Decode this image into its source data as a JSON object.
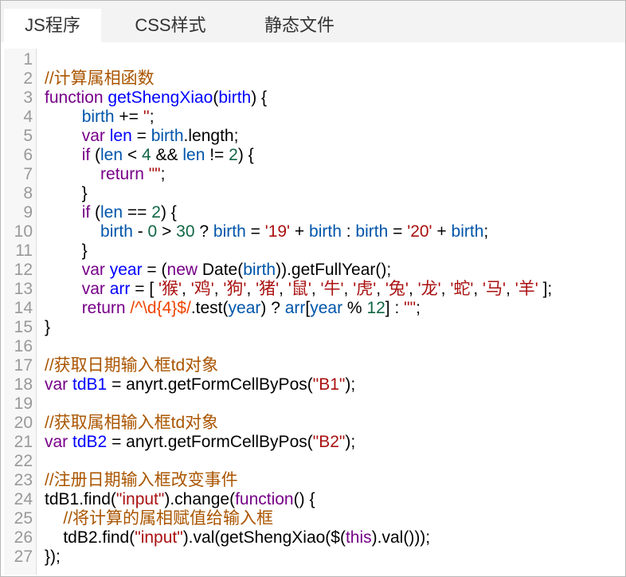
{
  "tabs": [
    {
      "label": "JS程序",
      "active": true
    },
    {
      "label": "CSS样式",
      "active": false
    },
    {
      "label": "静态文件",
      "active": false
    }
  ],
  "code_lines": [
    {
      "n": "1",
      "tokens": []
    },
    {
      "n": "2",
      "tokens": [
        [
          "cm",
          "//计算属相函数"
        ]
      ]
    },
    {
      "n": "3",
      "tokens": [
        [
          "kw",
          "function"
        ],
        [
          "",
          " "
        ],
        [
          "def",
          "getShengXiao"
        ],
        [
          "",
          "("
        ],
        [
          "def",
          "birth"
        ],
        [
          "",
          ") {"
        ]
      ]
    },
    {
      "n": "4",
      "tokens": [
        [
          "",
          "        "
        ],
        [
          "vr",
          "birth"
        ],
        [
          "",
          " += "
        ],
        [
          "st",
          "''"
        ],
        [
          "",
          ";"
        ]
      ]
    },
    {
      "n": "5",
      "tokens": [
        [
          "",
          "        "
        ],
        [
          "kw",
          "var"
        ],
        [
          "",
          " "
        ],
        [
          "def",
          "len"
        ],
        [
          "",
          " = "
        ],
        [
          "vr",
          "birth"
        ],
        [
          "",
          ".length;"
        ]
      ]
    },
    {
      "n": "6",
      "tokens": [
        [
          "",
          "        "
        ],
        [
          "kw",
          "if"
        ],
        [
          "",
          " ("
        ],
        [
          "vr",
          "len"
        ],
        [
          "",
          " < "
        ],
        [
          "nm",
          "4"
        ],
        [
          "",
          " && "
        ],
        [
          "vr",
          "len"
        ],
        [
          "",
          " != "
        ],
        [
          "nm",
          "2"
        ],
        [
          "",
          ") {"
        ]
      ]
    },
    {
      "n": "7",
      "tokens": [
        [
          "",
          "            "
        ],
        [
          "kw",
          "return"
        ],
        [
          "",
          " "
        ],
        [
          "st",
          "\"\""
        ],
        [
          "",
          ";"
        ]
      ]
    },
    {
      "n": "8",
      "tokens": [
        [
          "",
          "        }"
        ]
      ]
    },
    {
      "n": "9",
      "tokens": [
        [
          "",
          "        "
        ],
        [
          "kw",
          "if"
        ],
        [
          "",
          " ("
        ],
        [
          "vr",
          "len"
        ],
        [
          "",
          " == "
        ],
        [
          "nm",
          "2"
        ],
        [
          "",
          ") {"
        ]
      ]
    },
    {
      "n": "10",
      "tokens": [
        [
          "",
          "            "
        ],
        [
          "vr",
          "birth"
        ],
        [
          "",
          " - "
        ],
        [
          "nm",
          "0"
        ],
        [
          "",
          " > "
        ],
        [
          "nm",
          "30"
        ],
        [
          "",
          " ? "
        ],
        [
          "vr",
          "birth"
        ],
        [
          "",
          " = "
        ],
        [
          "st",
          "'19'"
        ],
        [
          "",
          " + "
        ],
        [
          "vr",
          "birth"
        ],
        [
          "",
          " : "
        ],
        [
          "vr",
          "birth"
        ],
        [
          "",
          " = "
        ],
        [
          "st",
          "'20'"
        ],
        [
          "",
          " + "
        ],
        [
          "vr",
          "birth"
        ],
        [
          "",
          ";"
        ]
      ]
    },
    {
      "n": "11",
      "tokens": [
        [
          "",
          "        }"
        ]
      ]
    },
    {
      "n": "12",
      "tokens": [
        [
          "",
          "        "
        ],
        [
          "kw",
          "var"
        ],
        [
          "",
          " "
        ],
        [
          "def",
          "year"
        ],
        [
          "",
          " = ("
        ],
        [
          "kw",
          "new"
        ],
        [
          "",
          " Date("
        ],
        [
          "vr",
          "birth"
        ],
        [
          "",
          ")).getFullYear();"
        ]
      ]
    },
    {
      "n": "13",
      "tokens": [
        [
          "",
          "        "
        ],
        [
          "kw",
          "var"
        ],
        [
          "",
          " "
        ],
        [
          "def",
          "arr"
        ],
        [
          "",
          " = [ "
        ],
        [
          "st",
          "'猴'"
        ],
        [
          "",
          ", "
        ],
        [
          "st",
          "'鸡'"
        ],
        [
          "",
          ", "
        ],
        [
          "st",
          "'狗'"
        ],
        [
          "",
          ", "
        ],
        [
          "st",
          "'猪'"
        ],
        [
          "",
          ", "
        ],
        [
          "st",
          "'鼠'"
        ],
        [
          "",
          ", "
        ],
        [
          "st",
          "'牛'"
        ],
        [
          "",
          ", "
        ],
        [
          "st",
          "'虎'"
        ],
        [
          "",
          ", "
        ],
        [
          "st",
          "'兔'"
        ],
        [
          "",
          ", "
        ],
        [
          "st",
          "'龙'"
        ],
        [
          "",
          ", "
        ],
        [
          "st",
          "'蛇'"
        ],
        [
          "",
          ", "
        ],
        [
          "st",
          "'马'"
        ],
        [
          "",
          ", "
        ],
        [
          "st",
          "'羊'"
        ],
        [
          "",
          " ];"
        ]
      ]
    },
    {
      "n": "14",
      "tokens": [
        [
          "",
          "        "
        ],
        [
          "kw",
          "return"
        ],
        [
          "",
          " "
        ],
        [
          "rx",
          "/^\\d{4}$/"
        ],
        [
          "",
          ".test("
        ],
        [
          "vr",
          "year"
        ],
        [
          "",
          ") ? "
        ],
        [
          "vr",
          "arr"
        ],
        [
          "",
          "["
        ],
        [
          "vr",
          "year"
        ],
        [
          "",
          " % "
        ],
        [
          "nm",
          "12"
        ],
        [
          "",
          "] : "
        ],
        [
          "st",
          "\"\""
        ],
        [
          "",
          ";"
        ]
      ]
    },
    {
      "n": "15",
      "tokens": [
        [
          "",
          "}"
        ]
      ]
    },
    {
      "n": "16",
      "tokens": []
    },
    {
      "n": "17",
      "tokens": [
        [
          "cm",
          "//获取日期输入框td对象"
        ]
      ]
    },
    {
      "n": "18",
      "tokens": [
        [
          "kw",
          "var"
        ],
        [
          "",
          " "
        ],
        [
          "def",
          "tdB1"
        ],
        [
          "",
          " = anyrt.getFormCellByPos("
        ],
        [
          "st",
          "\"B1\""
        ],
        [
          "",
          ");"
        ]
      ]
    },
    {
      "n": "19",
      "tokens": []
    },
    {
      "n": "20",
      "tokens": [
        [
          "cm",
          "//获取属相输入框td对象"
        ]
      ]
    },
    {
      "n": "21",
      "tokens": [
        [
          "kw",
          "var"
        ],
        [
          "",
          " "
        ],
        [
          "def",
          "tdB2"
        ],
        [
          "",
          " = anyrt.getFormCellByPos("
        ],
        [
          "st",
          "\"B2\""
        ],
        [
          "",
          ");"
        ]
      ]
    },
    {
      "n": "22",
      "tokens": []
    },
    {
      "n": "23",
      "tokens": [
        [
          "cm",
          "//注册日期输入框改变事件"
        ]
      ]
    },
    {
      "n": "24",
      "tokens": [
        [
          "",
          "tdB1.find("
        ],
        [
          "st",
          "\"input\""
        ],
        [
          "",
          ").change("
        ],
        [
          "kw",
          "function"
        ],
        [
          "",
          "() {"
        ]
      ]
    },
    {
      "n": "25",
      "tokens": [
        [
          "",
          "    "
        ],
        [
          "cm",
          "//将计算的属相赋值给输入框"
        ]
      ]
    },
    {
      "n": "26",
      "tokens": [
        [
          "",
          "    tdB2.find("
        ],
        [
          "st",
          "\"input\""
        ],
        [
          "",
          ").val(getShengXiao($("
        ],
        [
          "kw",
          "this"
        ],
        [
          "",
          ").val()));"
        ]
      ]
    },
    {
      "n": "27",
      "tokens": [
        [
          "",
          "});"
        ]
      ]
    }
  ]
}
